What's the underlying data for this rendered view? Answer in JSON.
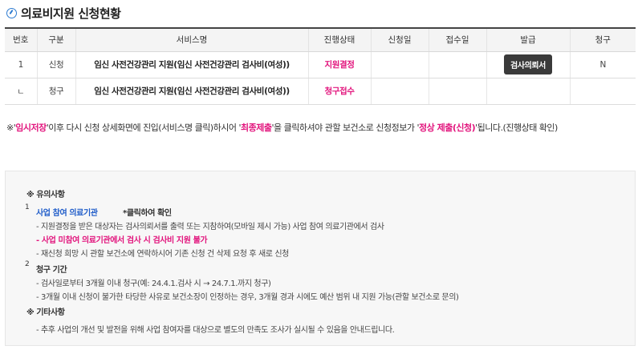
{
  "page": {
    "title": "의료비지원 신청현황",
    "pink_color": "#e2157d",
    "blue_color": "#1f5cc9"
  },
  "table": {
    "headers": [
      "번호",
      "구분",
      "서비스명",
      "진행상태",
      "신청일",
      "접수일",
      "발급",
      "청구"
    ],
    "rows": [
      {
        "no": "1",
        "type": "신청",
        "service": "임신 사전건강관리 지원(임신 사전건강관리 검사비(여성))",
        "status": "지원결정",
        "apply_date": "",
        "receipt_date": "",
        "issue_button": "검사의뢰서",
        "claim": "N"
      },
      {
        "no": "ㄴ",
        "type": "청구",
        "service": "임신 사전건강관리 지원(임신 사전건강관리 검사비(여성))",
        "status": "청구접수",
        "apply_date": "",
        "receipt_date": "",
        "issue_button": "",
        "claim": ""
      }
    ]
  },
  "note": {
    "p1": "※'",
    "h1": "임시저장",
    "p2": "'이후 다시 신청 상세화면에 진입(서비스명 클릭)하시어 '",
    "h2": "최종제출",
    "p3": "'을 클릭하셔야 관할 보건소로 신청정보가 '",
    "h3": "정상 제출(신청)",
    "p4": "'됩니다.(진행상태 확인)"
  },
  "caution": {
    "heading": "※ 유의사항",
    "item1_num": "1",
    "item1_link": "사업 참여 의료기관",
    "item1_suffix": "*클릭하여 확인",
    "item1_lines": [
      "지원결정을 받은 대상자는 검사의뢰서를 출력 또는 지참하여(모바일 제시 가능) 사업 참여 의료기관에서 검사",
      "사업 미참여 의료기관에서 검사 시 검사비 지원 불가",
      "재신청 희망 시 관할 보건소에 연락하시어 기존 신청 건 삭제 요청 후 새로 신청"
    ],
    "item2_num": "2",
    "item2_title": "청구 기간",
    "item2_lines": [
      "검사일로부터 3개월 이내 청구(예: 24.4.1.검사 시 → 24.7.1.까지 청구)",
      "3개월 이내 신청이 불가한 타당한 사유로 보건소장이 인정하는 경우, 3개월 경과 시에도 예산 범위 내 지원 가능(관할 보건소로 문의)"
    ],
    "other_heading": "※ 기타사항",
    "other_lines": [
      "추후 사업의 개선 및 발전을 위해 사업 참여자를 대상으로 별도의 만족도 조사가 실시될 수 있음을 안내드립니다."
    ]
  }
}
